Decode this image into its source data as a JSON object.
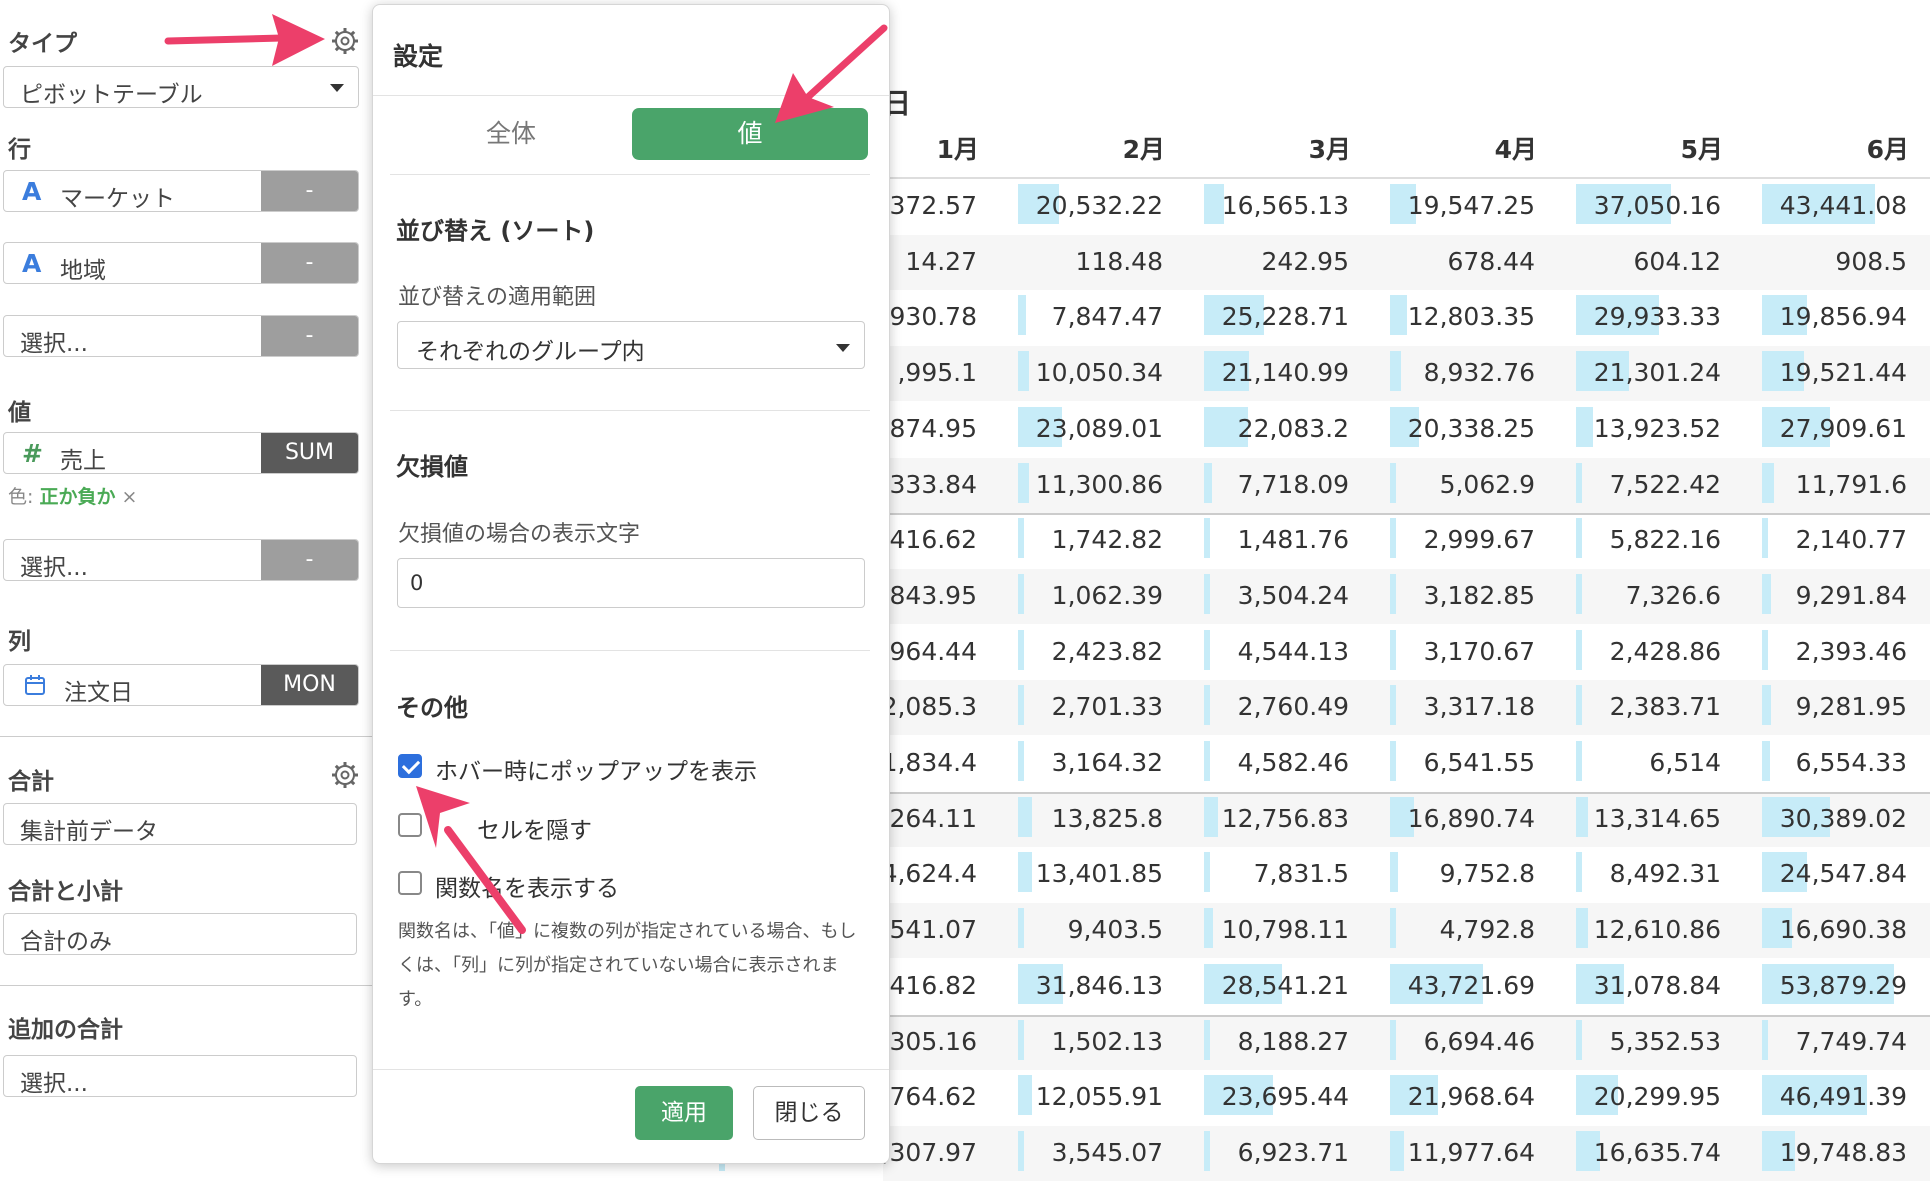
{
  "sidebar": {
    "type_label": "タイプ",
    "type_value": "ピボットテーブル",
    "rows_label": "行",
    "row_fields": [
      {
        "icon": "A",
        "name": "マーケット",
        "btn": "-"
      },
      {
        "icon": "A",
        "name": "地域",
        "btn": "-"
      }
    ],
    "row_select": {
      "placeholder": "選択...",
      "btn": "-"
    },
    "values_label": "値",
    "value_field": {
      "icon": "#",
      "name": "売上",
      "btn": "SUM"
    },
    "color_note": {
      "prefix": "色: ",
      "value": "正か負か",
      "remove": "×"
    },
    "value_select": {
      "placeholder": "選択...",
      "btn": "-"
    },
    "columns_label": "列",
    "column_field": {
      "name": "注文日",
      "btn": "MON"
    },
    "total_label": "合計",
    "total_value": "集計前データ",
    "subtotal_label": "合計と小計",
    "subtotal_value": "合計のみ",
    "extra_total_label": "追加の合計",
    "extra_total_value": "選択..."
  },
  "popup": {
    "title": "設定",
    "tabs": [
      "全体",
      "値"
    ],
    "active_tab": "値",
    "sort_heading": "並び替え (ソート)",
    "sort_scope_label": "並び替えの適用範囲",
    "sort_scope_value": "それぞれのグループ内",
    "missing_heading": "欠損値",
    "missing_label": "欠損値の場合の表示文字",
    "missing_value": "0",
    "other_heading": "その他",
    "options": [
      {
        "label": "ホバー時にポップアップを表示",
        "checked": true
      },
      {
        "label": "空のセルを隠す",
        "visible_label": "セルを隠す",
        "checked": false
      },
      {
        "label": "関数名を表示する",
        "checked": false
      }
    ],
    "note": "関数名は、「値」に複数の列が指定されている場合、もしくは、「列」に列が指定されていない場合に表示されます。",
    "apply_label": "適用",
    "close_label": "閉じる"
  },
  "table": {
    "title_partial": "日",
    "columns": [
      "1月",
      "2月",
      "3月",
      "4月",
      "5月",
      "6月"
    ],
    "rows": [
      {
        "cells": [
          ",372.57",
          "20,532.22",
          "16,565.13",
          "19,547.25",
          "37,050.16",
          "43,441.08"
        ],
        "bars": [
          0.3,
          0.27,
          0.13,
          0.17,
          0.63,
          0.75
        ]
      },
      {
        "cells": [
          "14.27",
          "118.48",
          "242.95",
          "678.44",
          "604.12",
          "908.5"
        ],
        "bars": [
          0,
          0,
          0,
          0,
          0,
          0
        ]
      },
      {
        "cells": [
          ",930.78",
          "7,847.47",
          "25,228.71",
          "12,803.35",
          "29,933.33",
          "19,856.94"
        ],
        "bars": [
          0.08,
          0.05,
          0.4,
          0.11,
          0.55,
          0.3
        ]
      },
      {
        "cells": [
          ",995.1",
          "10,050.34",
          "21,140.99",
          "8,932.76",
          "21,301.24",
          "19,521.44"
        ],
        "bars": [
          0.1,
          0.07,
          0.3,
          0.07,
          0.35,
          0.28
        ]
      },
      {
        "cells": [
          ",874.95",
          "23,089.01",
          "22,083.2",
          "20,338.25",
          "13,923.52",
          "27,909.61"
        ],
        "bars": [
          0.12,
          0.29,
          0.29,
          0.19,
          0.11,
          0.45
        ]
      },
      {
        "cells": [
          ",333.84",
          "11,300.86",
          "7,718.09",
          "5,062.9",
          "7,522.42",
          "11,791.6"
        ],
        "bars": [
          0.06,
          0.07,
          0.05,
          0.04,
          0.04,
          0.08
        ]
      },
      {
        "cells": [
          ",416.62",
          "1,742.82",
          "1,481.76",
          "2,999.67",
          "5,822.16",
          "2,140.77"
        ],
        "bars": [
          0.03,
          0.02,
          0.02,
          0.02,
          0.03,
          0.03
        ]
      },
      {
        "cells": [
          ",843.95",
          "1,062.39",
          "3,504.24",
          "3,182.85",
          "7,326.6",
          "9,291.84"
        ],
        "bars": [
          0.03,
          0.02,
          0.02,
          0.02,
          0.03,
          0.06
        ]
      },
      {
        "cells": [
          "964.44",
          "2,423.82",
          "4,544.13",
          "3,170.67",
          "2,428.86",
          "2,393.46"
        ],
        "bars": [
          0.03,
          0.02,
          0.02,
          0.02,
          0.03,
          0.03
        ]
      },
      {
        "cells": [
          "2,085.3",
          "2,701.33",
          "2,760.49",
          "3,317.18",
          "2,383.71",
          "9,281.95"
        ],
        "bars": [
          0.03,
          0.02,
          0.02,
          0.02,
          0.03,
          0.06
        ]
      },
      {
        "cells": [
          "1,834.4",
          "3,164.32",
          "4,582.46",
          "6,541.55",
          "6,514",
          "6,554.33"
        ],
        "bars": [
          0.03,
          0.02,
          0.02,
          0.02,
          0.03,
          0.05
        ]
      },
      {
        "cells": [
          ",264.11",
          "13,825.8",
          "12,756.83",
          "16,890.74",
          "13,314.65",
          "30,389.02"
        ],
        "bars": [
          0.14,
          0.09,
          0.09,
          0.16,
          0.08,
          0.45
        ]
      },
      {
        "cells": [
          "4,624.4",
          "13,401.85",
          "7,831.5",
          "9,752.8",
          "8,492.31",
          "24,547.84"
        ],
        "bars": [
          0.04,
          0.09,
          0.04,
          0.05,
          0.03,
          0.3
        ]
      },
      {
        "cells": [
          ",541.07",
          "9,403.5",
          "10,798.11",
          "4,792.8",
          "12,610.86",
          "16,690.38"
        ],
        "bars": [
          0.03,
          0.04,
          0.06,
          0.02,
          0.08,
          0.2
        ]
      },
      {
        "cells": [
          ",416.82",
          "31,846.13",
          "28,541.21",
          "43,721.69",
          "31,078.84",
          "53,879.29"
        ],
        "bars": [
          0.05,
          0.3,
          0.52,
          0.62,
          0.32,
          0.88
        ]
      },
      {
        "cells": [
          ",305.16",
          "1,502.13",
          "8,188.27",
          "6,694.46",
          "5,352.53",
          "7,749.74"
        ],
        "bars": [
          0.03,
          0.02,
          0.03,
          0.02,
          0.03,
          0.03
        ]
      },
      {
        "cells": [
          ",764.62",
          "12,055.91",
          "23,695.44",
          "21,968.64",
          "20,299.95",
          "46,491.39"
        ],
        "bars": [
          0.03,
          0.09,
          0.46,
          0.32,
          0.28,
          0.7
        ]
      },
      {
        "cells": [
          ",307.97",
          "3,545.07",
          "6,923.71",
          "11,977.64",
          "16,635.74",
          "19,748.83"
        ],
        "bars": [
          0.03,
          0.02,
          0.03,
          0.09,
          0.16,
          0.22
        ]
      }
    ],
    "group_breaks_after": [
      5,
      10,
      14
    ]
  },
  "colors": {
    "accent_green": "#4aa46a",
    "bar_blue": "#c7ecf8",
    "arrow_pink": "#ec3f6a",
    "checkbox_blue": "#2d6fdd"
  }
}
